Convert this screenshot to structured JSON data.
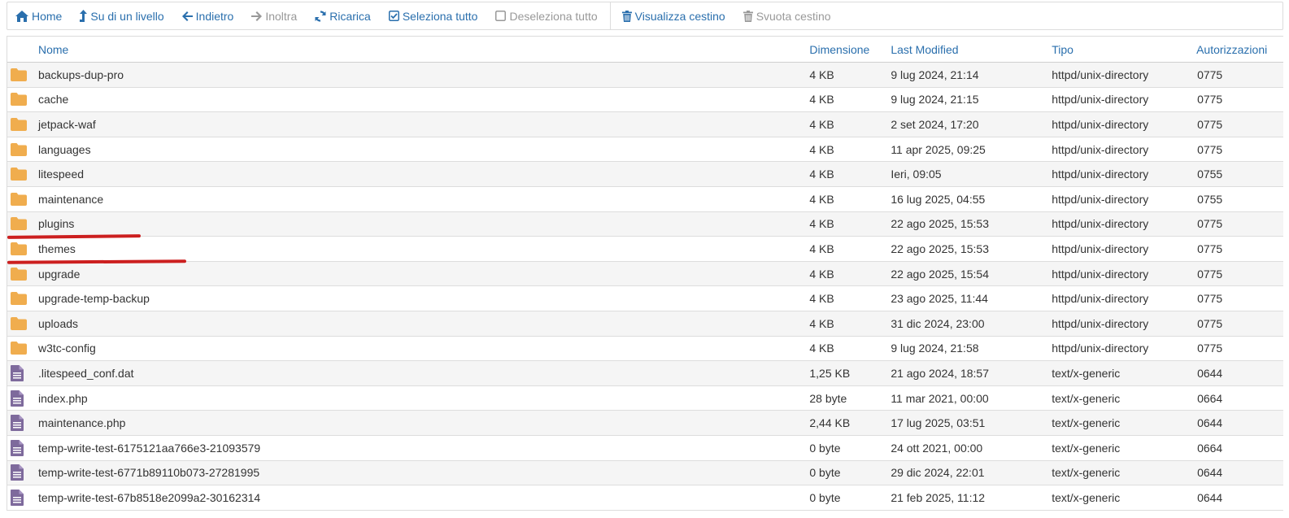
{
  "toolbar": {
    "home": "Home",
    "up": "Su di un livello",
    "back": "Indietro",
    "forward": "Inoltra",
    "reload": "Ricarica",
    "select_all": "Seleziona tutto",
    "deselect_all": "Deseleziona tutto",
    "view_trash": "Visualizza cestino",
    "empty_trash": "Svuota cestino"
  },
  "table": {
    "headers": {
      "name": "Nome",
      "size": "Dimensione",
      "modified": "Last Modified",
      "type": "Tipo",
      "perms": "Autorizzazioni"
    },
    "rows": [
      {
        "icon": "folder-icon",
        "name": "backups-dup-pro",
        "size": "4 KB",
        "modified": "9 lug 2024, 21:14",
        "type": "httpd/unix-directory",
        "perms": "0775"
      },
      {
        "icon": "folder-icon",
        "name": "cache",
        "size": "4 KB",
        "modified": "9 lug 2024, 21:15",
        "type": "httpd/unix-directory",
        "perms": "0775"
      },
      {
        "icon": "folder-icon",
        "name": "jetpack-waf",
        "size": "4 KB",
        "modified": "2 set 2024, 17:20",
        "type": "httpd/unix-directory",
        "perms": "0775"
      },
      {
        "icon": "folder-icon",
        "name": "languages",
        "size": "4 KB",
        "modified": "11 apr 2025, 09:25",
        "type": "httpd/unix-directory",
        "perms": "0775"
      },
      {
        "icon": "folder-icon",
        "name": "litespeed",
        "size": "4 KB",
        "modified": "Ieri, 09:05",
        "type": "httpd/unix-directory",
        "perms": "0755"
      },
      {
        "icon": "folder-icon",
        "name": "maintenance",
        "size": "4 KB",
        "modified": "16 lug 2025, 04:55",
        "type": "httpd/unix-directory",
        "perms": "0755"
      },
      {
        "icon": "folder-icon",
        "name": "plugins",
        "size": "4 KB",
        "modified": "22 ago 2025, 15:53",
        "type": "httpd/unix-directory",
        "perms": "0775"
      },
      {
        "icon": "folder-icon",
        "name": "themes",
        "size": "4 KB",
        "modified": "22 ago 2025, 15:53",
        "type": "httpd/unix-directory",
        "perms": "0775"
      },
      {
        "icon": "folder-icon",
        "name": "upgrade",
        "size": "4 KB",
        "modified": "22 ago 2025, 15:54",
        "type": "httpd/unix-directory",
        "perms": "0775"
      },
      {
        "icon": "folder-icon",
        "name": "upgrade-temp-backup",
        "size": "4 KB",
        "modified": "23 ago 2025, 11:44",
        "type": "httpd/unix-directory",
        "perms": "0775"
      },
      {
        "icon": "folder-icon",
        "name": "uploads",
        "size": "4 KB",
        "modified": "31 dic 2024, 23:00",
        "type": "httpd/unix-directory",
        "perms": "0775"
      },
      {
        "icon": "folder-icon",
        "name": "w3tc-config",
        "size": "4 KB",
        "modified": "9 lug 2024, 21:58",
        "type": "httpd/unix-directory",
        "perms": "0775"
      },
      {
        "icon": "file-icon",
        "name": ".litespeed_conf.dat",
        "size": "1,25 KB",
        "modified": "21 ago 2024, 18:57",
        "type": "text/x-generic",
        "perms": "0644"
      },
      {
        "icon": "file-icon",
        "name": "index.php",
        "size": "28 byte",
        "modified": "11 mar 2021, 00:00",
        "type": "text/x-generic",
        "perms": "0664"
      },
      {
        "icon": "file-icon",
        "name": "maintenance.php",
        "size": "2,44 KB",
        "modified": "17 lug 2025, 03:51",
        "type": "text/x-generic",
        "perms": "0644"
      },
      {
        "icon": "file-icon",
        "name": "temp-write-test-6175121aa766e3-21093579",
        "size": "0 byte",
        "modified": "24 ott 2021, 00:00",
        "type": "text/x-generic",
        "perms": "0664"
      },
      {
        "icon": "file-icon",
        "name": "temp-write-test-6771b89110b073-27281995",
        "size": "0 byte",
        "modified": "29 dic 2024, 22:01",
        "type": "text/x-generic",
        "perms": "0644"
      },
      {
        "icon": "file-icon",
        "name": "temp-write-test-67b8518e2099a2-30162314",
        "size": "0 byte",
        "modified": "21 feb 2025, 11:12",
        "type": "text/x-generic",
        "perms": "0644"
      }
    ]
  },
  "colors": {
    "link": "#2a6fad",
    "disabled": "#999999",
    "folder": "#f0ad4e",
    "file": "#7e6a9c",
    "annotation": "#cc1f1f"
  }
}
